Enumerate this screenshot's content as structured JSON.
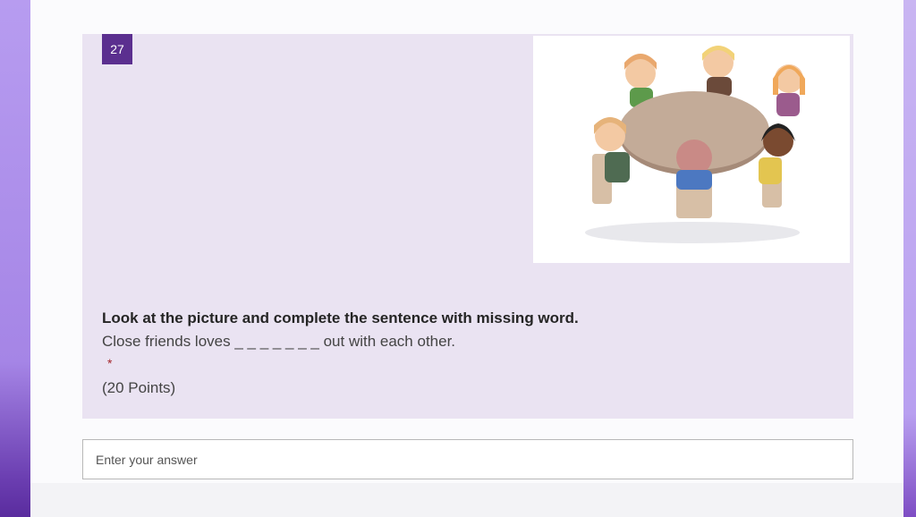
{
  "question": {
    "number": "27",
    "title": "Look at the picture and complete the sentence with missing word.",
    "text": "Close friends loves  _ _ _ _ _ _ _ out with each other.",
    "required_marker": "*",
    "points": "(20 Points)"
  },
  "answer": {
    "placeholder": "Enter your answer"
  },
  "colors": {
    "accent": "#5b2f8f",
    "card_background": "#eae3f2",
    "required": "#a4262c"
  }
}
